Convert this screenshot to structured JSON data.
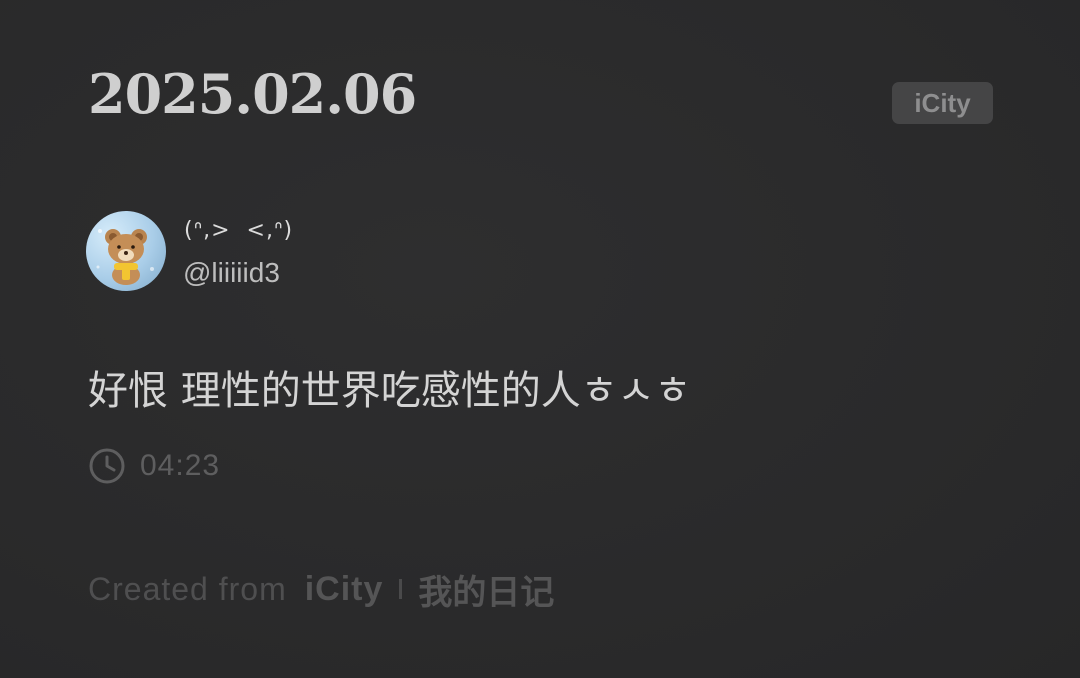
{
  "post": {
    "date": "2025.02.06",
    "brand_badge": "iCity",
    "author": {
      "nickname": "(ᐢ,>  <,ᐢ)",
      "handle": "@liiiiid3",
      "avatar": "bear-avatar"
    },
    "content": "好恨 理性的世界吃感性的人ㅎㅅㅎ",
    "time": "04:23",
    "time_icon": "clock-icon"
  },
  "footer": {
    "prefix": "Created from",
    "app": "iCity",
    "diary": "我的日记"
  },
  "colors": {
    "background": "#2a2a2b",
    "badge_background": "#454546",
    "text_primary": "#d4d4d4",
    "text_muted": "#5e5e5f"
  }
}
